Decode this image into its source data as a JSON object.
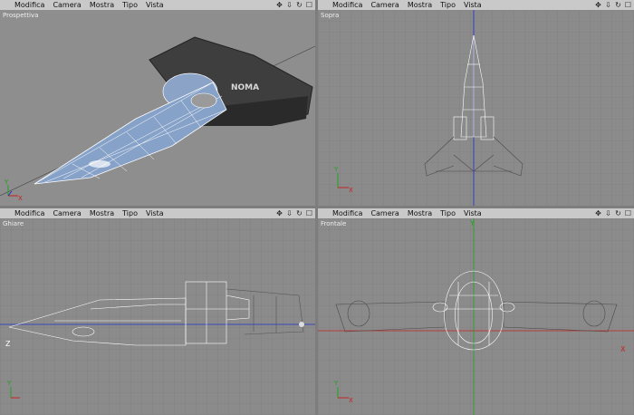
{
  "viewports": [
    {
      "name": "Prospettiva",
      "menu": [
        "Modifica",
        "Camera",
        "Mostra",
        "Tipo",
        "Vista"
      ]
    },
    {
      "name": "Sopra",
      "menu": [
        "Modifica",
        "Camera",
        "Mostra",
        "Tipo",
        "Vista"
      ]
    },
    {
      "name": "Ghiare",
      "menu": [
        "Modifica",
        "Camera",
        "Mostra",
        "Tipo",
        "Vista"
      ]
    },
    {
      "name": "Frontale",
      "menu": [
        "Modifica",
        "Camera",
        "Mostra",
        "Tipo",
        "Vista"
      ]
    }
  ],
  "nav_icons": [
    "move-icon",
    "zoom-icon",
    "rotate-icon",
    "maximize-icon"
  ],
  "model_decal": "NOMA",
  "axes": {
    "x": "X",
    "y": "Y",
    "z": "Z"
  },
  "colors": {
    "x_axis": "#c82020",
    "y_axis": "#20a020",
    "z_axis": "#2030c8",
    "grid": "#7a7a7a",
    "wire": "#ffffff"
  }
}
